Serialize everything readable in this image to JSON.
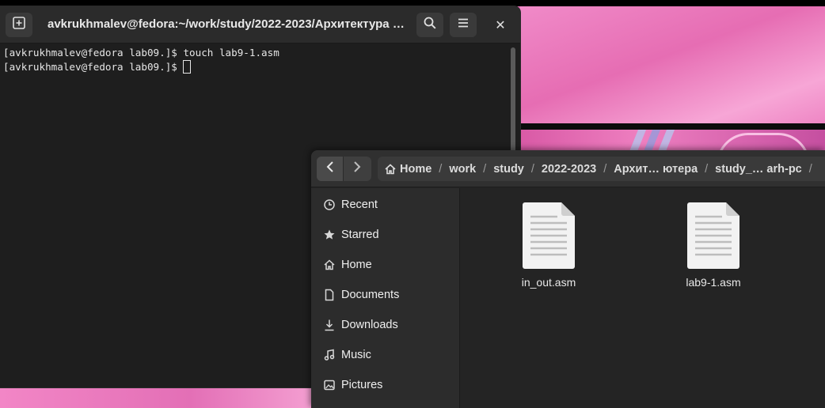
{
  "terminal": {
    "title": "avkrukhmalev@fedora:~/work/study/2022-2023/Архитектура к…",
    "lines": [
      "[avkrukhmalev@fedora lab09.]$ touch lab9-1.asm",
      "[avkrukhmalev@fedora lab09.]$ "
    ],
    "icons": {
      "new_tab": "new-tab-icon",
      "search": "search-icon",
      "menu": "hamburger-menu-icon",
      "close": "close-icon"
    },
    "close_glyph": "✕"
  },
  "files": {
    "nav": {
      "back": "‹",
      "forward": "›"
    },
    "path": {
      "home": "Home",
      "segments": [
        "work",
        "study",
        "2022-2023",
        "Архит… ютера",
        "study_… arh-pc"
      ],
      "separator": "/"
    },
    "sidebar": [
      {
        "label": "Recent",
        "icon": "clock-icon"
      },
      {
        "label": "Starred",
        "icon": "star-icon"
      },
      {
        "label": "Home",
        "icon": "home-icon"
      },
      {
        "label": "Documents",
        "icon": "document-icon"
      },
      {
        "label": "Downloads",
        "icon": "download-icon"
      },
      {
        "label": "Music",
        "icon": "music-icon"
      },
      {
        "label": "Pictures",
        "icon": "picture-icon"
      }
    ],
    "items": [
      {
        "name": "in_out.asm",
        "icon": "text-file-icon"
      },
      {
        "name": "lab9-1.asm",
        "icon": "text-file-icon"
      }
    ]
  },
  "colors": {
    "terminal_bg": "#1e1e1e",
    "headerbar": "#2b2b2b",
    "files_bg": "#242424",
    "sidebar_bg": "#2c2c2c",
    "wallpaper_pink": "#e873b8"
  }
}
